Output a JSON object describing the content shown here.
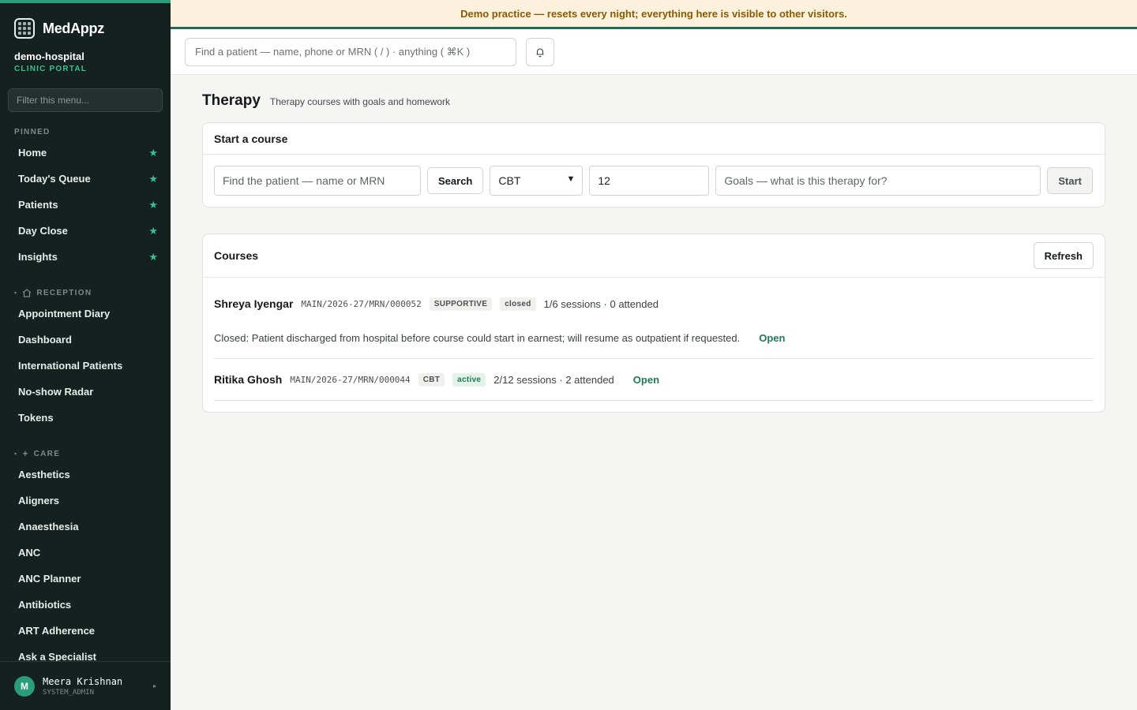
{
  "brand": {
    "name": "MedAppz"
  },
  "org": {
    "name": "demo-hospital",
    "subtitle": "CLINIC PORTAL"
  },
  "sidebar": {
    "filter_placeholder": "Filter this menu...",
    "pinned_label": "PINNED",
    "pinned": [
      {
        "label": "Home"
      },
      {
        "label": "Today's Queue"
      },
      {
        "label": "Patients"
      },
      {
        "label": "Day Close"
      },
      {
        "label": "Insights"
      }
    ],
    "reception_label": "RECEPTION",
    "reception": [
      {
        "label": "Appointment Diary"
      },
      {
        "label": "Dashboard"
      },
      {
        "label": "International Patients"
      },
      {
        "label": "No-show Radar"
      },
      {
        "label": "Tokens"
      }
    ],
    "care_label": "CARE",
    "care": [
      {
        "label": "Aesthetics"
      },
      {
        "label": "Aligners"
      },
      {
        "label": "Anaesthesia"
      },
      {
        "label": "ANC"
      },
      {
        "label": "ANC Planner"
      },
      {
        "label": "Antibiotics"
      },
      {
        "label": "ART Adherence"
      },
      {
        "label": "Ask a Specialist"
      }
    ]
  },
  "user": {
    "initial": "M",
    "name": "Meera Krishnan",
    "role": "SYSTEM_ADMIN"
  },
  "banner": {
    "text": "Demo practice — resets every night; everything here is visible to other visitors."
  },
  "topbar": {
    "search_placeholder": "Find a patient — name, phone or MRN ( / ) · anything ( ⌘K )"
  },
  "page": {
    "title": "Therapy",
    "subtitle": "Therapy courses with goals and homework"
  },
  "start_course": {
    "title": "Start a course",
    "patient_placeholder": "Find the patient — name or MRN",
    "search_label": "Search",
    "therapy_type": "CBT",
    "sessions_value": "12",
    "goals_placeholder": "Goals — what is this therapy for?",
    "start_label": "Start"
  },
  "courses": {
    "title": "Courses",
    "refresh_label": "Refresh",
    "items": [
      {
        "name": "Shreya Iyengar",
        "mrn": "MAIN/2026-27/MRN/000052",
        "type": "SUPPORTIVE",
        "status": "closed",
        "sessions": "1/6 sessions · 0 attended",
        "note": "Closed: Patient discharged from hospital before course could start in earnest; will resume as outpatient if requested.",
        "open_label": "Open"
      },
      {
        "name": "Ritika Ghosh",
        "mrn": "MAIN/2026-27/MRN/000044",
        "type": "CBT",
        "status": "active",
        "sessions": "2/12 sessions · 2 attended",
        "open_label": "Open"
      }
    ]
  },
  "colors": {
    "accent": "#2a9d79",
    "sidebar_bg": "#14211f",
    "banner_bg": "#fbf1dc",
    "link": "#1f7a55"
  }
}
